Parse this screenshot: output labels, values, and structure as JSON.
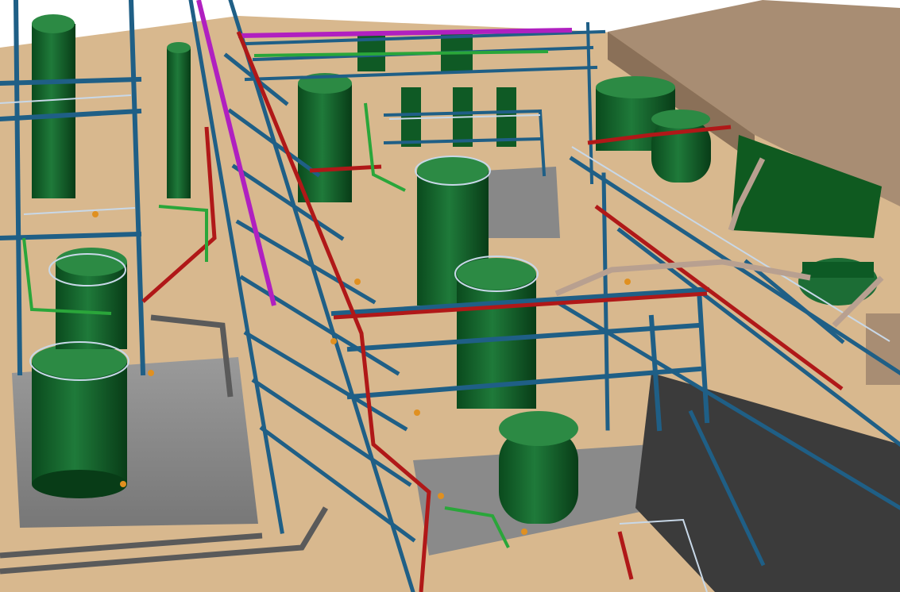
{
  "scene": {
    "colors": {
      "sky": "#ffffff",
      "ground": "#d8b88e",
      "slab": "#8c8c8c",
      "steel": "#1f5f86",
      "steel_light": "#2f7aa6",
      "vessel": "#0d5a25",
      "vessel_light": "#2f8a45",
      "pipe_red": "#b01818",
      "pipe_green": "#2aa63a",
      "pipe_magenta": "#b020c0",
      "pipe_grey": "#5a5a5a",
      "pipe_tan": "#b8a090",
      "railing": "#c8d8e8",
      "valve": "#e09020",
      "roof": "#a88d73",
      "roof_side": "#8a7058",
      "building_green": "#0f5a20"
    }
  }
}
